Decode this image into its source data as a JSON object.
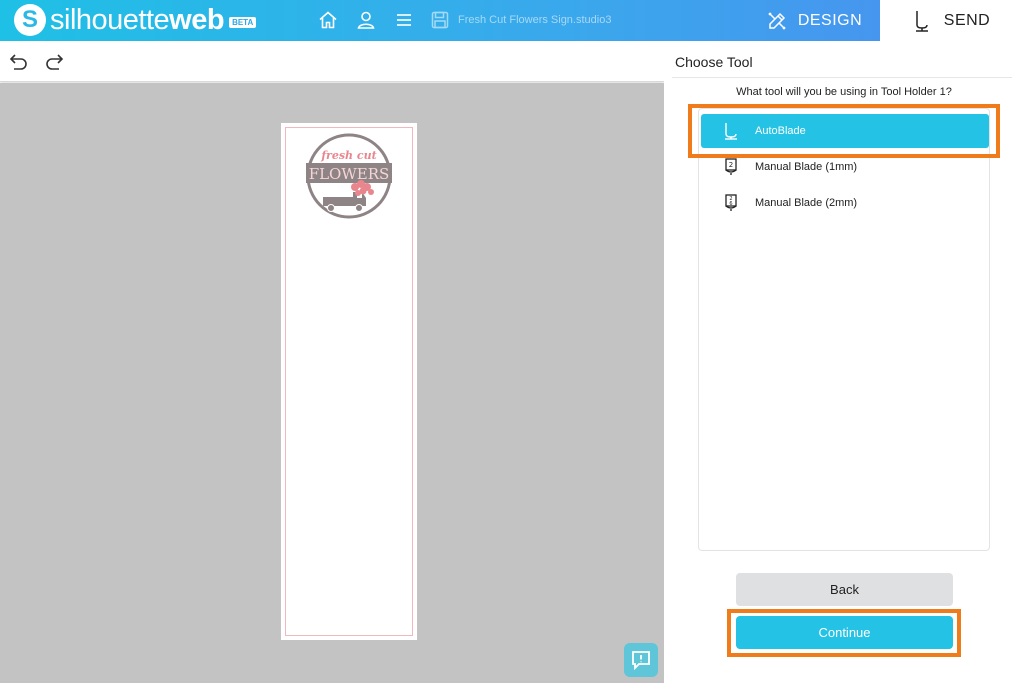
{
  "header": {
    "logo_regular": "silhouette",
    "logo_bold": "web",
    "beta": "BETA",
    "file_name": "Fresh Cut Flowers Sign.studio3",
    "tabs": [
      {
        "label": "DESIGN",
        "icon": "design-tools-icon",
        "active": false
      },
      {
        "label": "SEND",
        "icon": "send-blade-icon",
        "active": true
      }
    ],
    "icons": [
      "home-icon",
      "user-icon",
      "menu-icon",
      "save-icon"
    ]
  },
  "toolbar": {
    "icons": [
      "undo-icon",
      "redo-icon"
    ]
  },
  "design": {
    "script_text": "fresh cut",
    "banner_text": "FLOWERS"
  },
  "panel": {
    "title": "Choose Tool",
    "question": "What tool will you be using in Tool Holder 1?",
    "tools": [
      {
        "label": "AutoBlade",
        "selected": true
      },
      {
        "label": "Manual Blade (1mm)",
        "selected": false
      },
      {
        "label": "Manual Blade (2mm)",
        "selected": false
      }
    ],
    "back_label": "Back",
    "continue_label": "Continue"
  },
  "colors": {
    "accent": "#24c2e4",
    "highlight": "#ef7b1a",
    "canvas": "#c3c3c3",
    "design_gray": "#8f8485",
    "design_pink": "#e9868d"
  }
}
